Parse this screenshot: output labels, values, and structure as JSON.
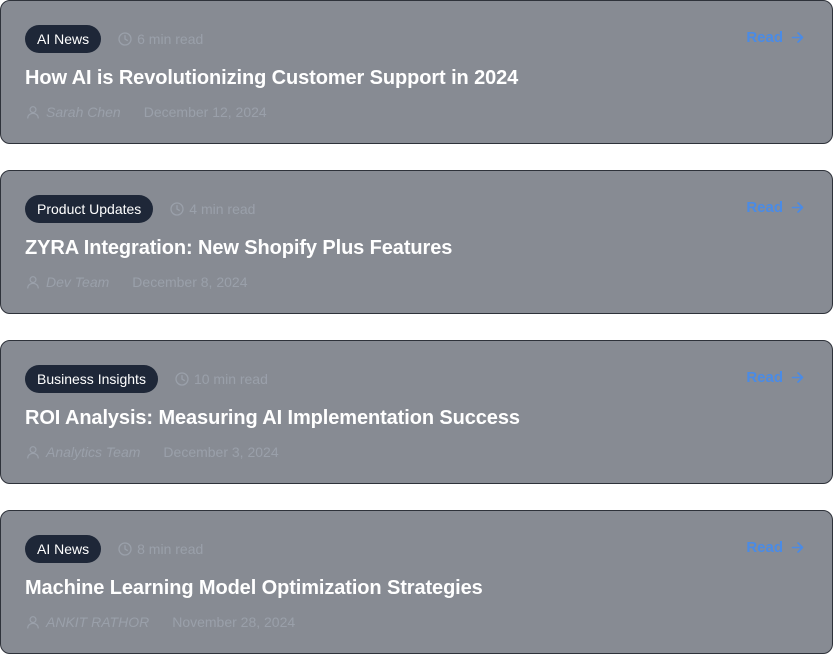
{
  "posts": [
    {
      "category": "AI News",
      "read_time": "6 min read",
      "title": "How AI is Revolutionizing Customer Support in 2024",
      "author": "Sarah Chen",
      "date": "December 12, 2024",
      "read_label": "Read"
    },
    {
      "category": "Product Updates",
      "read_time": "4 min read",
      "title": "ZYRA Integration: New Shopify Plus Features",
      "author": "Dev Team",
      "date": "December 8, 2024",
      "read_label": "Read"
    },
    {
      "category": "Business Insights",
      "read_time": "10 min read",
      "title": "ROI Analysis: Measuring AI Implementation Success",
      "author": "Analytics Team",
      "date": "December 3, 2024",
      "read_label": "Read"
    },
    {
      "category": "AI News",
      "read_time": "8 min read",
      "title": "Machine Learning Model Optimization Strategies",
      "author": "ANKIT RATHOR",
      "date": "November 28, 2024",
      "read_label": "Read"
    }
  ],
  "icons": {
    "read_time": "clock-icon",
    "author": "user-icon",
    "read_link": "arrow-right-icon"
  },
  "colors": {
    "card_background": "#878b93",
    "badge_background": "#1e2738",
    "accent": "#4a8be6",
    "muted_text": "#9aa0aa"
  }
}
